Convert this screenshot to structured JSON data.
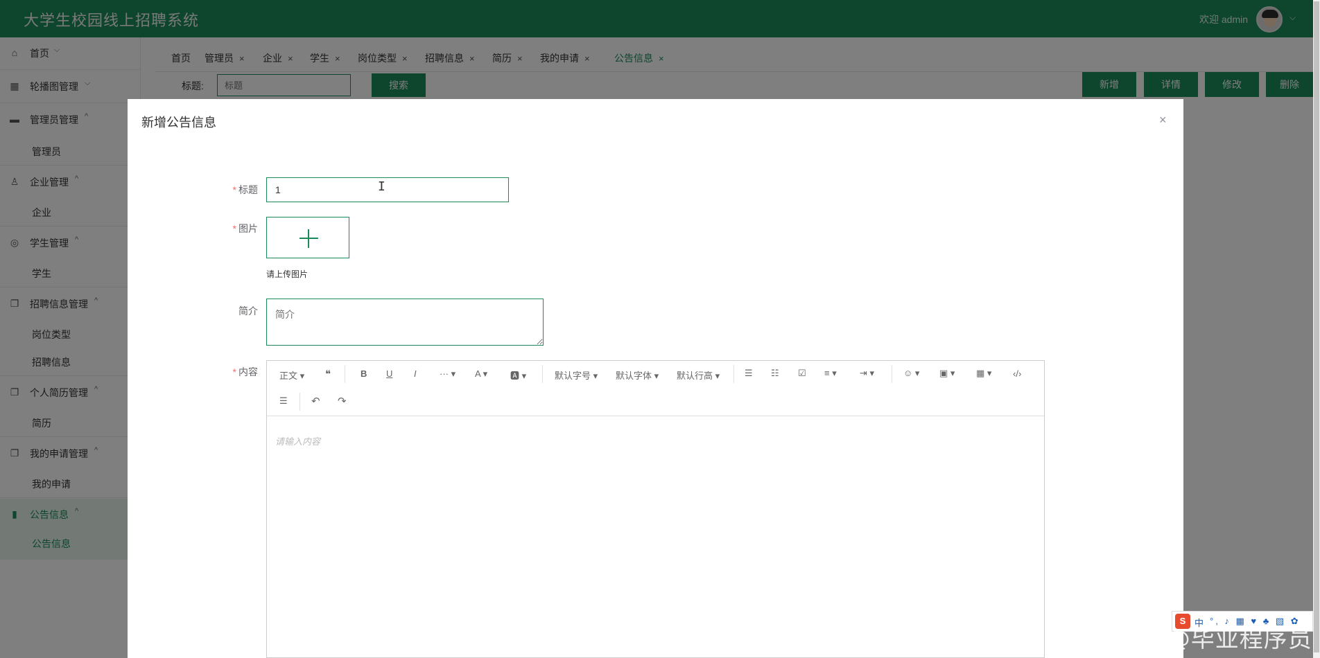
{
  "app": {
    "title": "大学生校园线上招聘系统",
    "welcome": "欢迎 admin",
    "caret": "⌵"
  },
  "sidebar": {
    "groups": [
      {
        "label": "首页",
        "icon": "home-icon",
        "glyph": "⌂",
        "arrow": "⌵"
      },
      {
        "label": "轮播图管理",
        "icon": "grid-icon",
        "glyph": "▦",
        "arrow": "⌵"
      },
      {
        "label": "管理员管理",
        "icon": "monitor-icon",
        "glyph": "▬",
        "arrow": "^"
      },
      {
        "label": "企业管理",
        "icon": "user-icon",
        "glyph": "♙",
        "arrow": "^"
      },
      {
        "label": "学生管理",
        "icon": "student-icon",
        "glyph": "◎",
        "arrow": "^"
      },
      {
        "label": "招聘信息管理",
        "icon": "copy-icon",
        "glyph": "❐",
        "arrow": "^"
      },
      {
        "label": "个人简历管理",
        "icon": "copy-icon",
        "glyph": "❐",
        "arrow": "^"
      },
      {
        "label": "我的申请管理",
        "icon": "copy-icon",
        "glyph": "❐",
        "arrow": "^"
      },
      {
        "label": "公告信息",
        "icon": "notice-icon",
        "glyph": "▮",
        "arrow": "^"
      }
    ],
    "subs": {
      "admin": "管理员",
      "company": "企业",
      "student": "学生",
      "job_type": "岗位类型",
      "job_info": "招聘信息",
      "resume": "简历",
      "my_apply": "我的申请",
      "notice": "公告信息"
    }
  },
  "tabs": [
    {
      "label": "首页",
      "closable": false
    },
    {
      "label": "管理员",
      "closable": true
    },
    {
      "label": "企业",
      "closable": true
    },
    {
      "label": "学生",
      "closable": true
    },
    {
      "label": "岗位类型",
      "closable": true
    },
    {
      "label": "招聘信息",
      "closable": true
    },
    {
      "label": "简历",
      "closable": true
    },
    {
      "label": "我的申请",
      "closable": true
    },
    {
      "label": "公告信息",
      "closable": true,
      "active": true
    }
  ],
  "tab_close": "×",
  "search": {
    "label": "标题:",
    "placeholder": "标题",
    "button": "搜索"
  },
  "actions": {
    "add": "新增",
    "detail": "详情",
    "edit": "修改",
    "delete": "删除"
  },
  "dialog": {
    "title": "新增公告信息",
    "close": "×",
    "required_mark": "*",
    "fields": {
      "title_label": "标题",
      "title_value": "1",
      "image_label": "图片",
      "image_tip": "请上传图片",
      "intro_label": "简介",
      "intro_placeholder": "简介",
      "content_label": "内容",
      "content_placeholder": "请输入内容"
    },
    "toolbar": {
      "paragraph": "正文 ▾",
      "quote": "❝",
      "bold": "B",
      "underline": "U",
      "italic": "I",
      "more": "··· ▾",
      "font_color": "A ▾",
      "bg_color": "🅰 ▾",
      "font_size": "默认字号 ▾",
      "font_family": "默认字体 ▾",
      "line_height": "默认行高 ▾",
      "bullet_list": "☰",
      "numbered_list": "☷",
      "todo": "☑",
      "align": "≡ ▾",
      "indent": "⇥ ▾",
      "emoji": "☺ ▾",
      "image": "▣ ▾",
      "table": "▦ ▾",
      "code": "‹/›",
      "divider": "☰",
      "undo": "↶",
      "redo": "↷"
    }
  },
  "ime": {
    "logo": "S",
    "lang": "中",
    "icons": "°, ♪ ▦ ♥ ♣ ▧ ✿"
  },
  "watermark": "CSDN @毕业程序员",
  "colors": {
    "primary": "#1a8a5a",
    "overlay": "rgba(0,0,0,0.5)",
    "required": "#f56c6c"
  }
}
